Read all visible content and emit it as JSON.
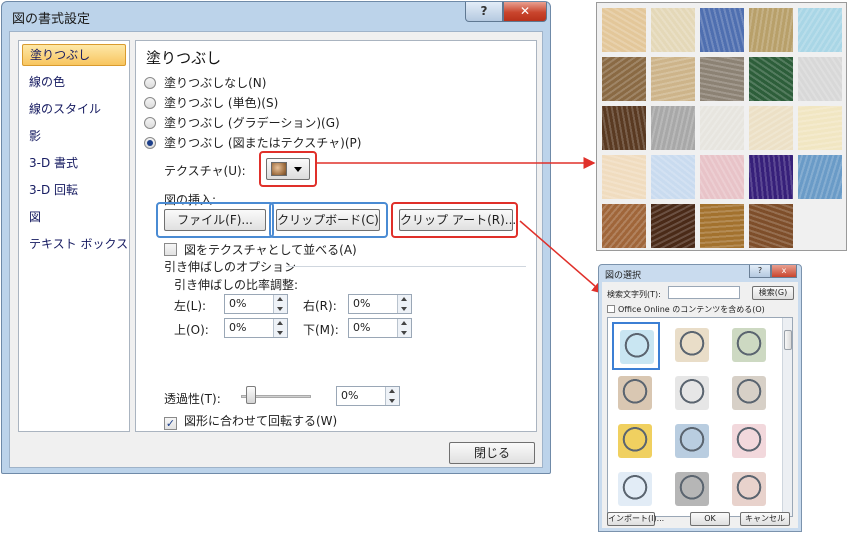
{
  "dialog": {
    "title": "図の書式設定",
    "help_glyph": "?",
    "close_glyph": "✕",
    "close_button": "閉じる"
  },
  "nav": {
    "items": [
      "塗りつぶし",
      "線の色",
      "線のスタイル",
      "影",
      "3-D 書式",
      "3-D 回転",
      "図",
      "テキスト ボックス"
    ],
    "selected": "塗りつぶし"
  },
  "fill": {
    "section_title": "塗りつぶし",
    "options": [
      "塗りつぶしなし(N)",
      "塗りつぶし (単色)(S)",
      "塗りつぶし (グラデーション)(G)",
      "塗りつぶし (図またはテクスチャ)(P)"
    ],
    "selected_option": "塗りつぶし (図またはテクスチャ)(P)",
    "texture_label": "テクスチャ(U):",
    "insert_from_label": "図の挿入:",
    "file_button": "ファイル(F)...",
    "clipboard_button": "クリップボード(C)",
    "clipart_button": "クリップ アート(R)...",
    "tile_checkbox": "図をテクスチャとして並べる(A)",
    "tile_checked": false,
    "stretch_options": "引き伸ばしのオプション",
    "offsets_label": "引き伸ばしの比率調整:",
    "left_label": "左(L):",
    "left_value": "0%",
    "right_label": "右(R):",
    "right_value": "0%",
    "top_label": "上(O):",
    "top_value": "0%",
    "bottom_label": "下(M):",
    "bottom_value": "0%",
    "transparency_label": "透過性(T):",
    "transparency_value": "0%",
    "rotate_checkbox": "図形に合わせて回転する(W)",
    "rotate_checked": true
  },
  "colors": {
    "highlight_blue": "#4a8bd3",
    "highlight_red": "#e0302a",
    "selected_nav": "#f8c55f"
  },
  "textures": [
    "#e3c79a",
    "#e4d8b8",
    "#4f6fb0",
    "#b8a06a",
    "#a9d6e6",
    "#8a6a44",
    "#cdb48a",
    "#8c8274",
    "#2d5e3a",
    "#d8d8d8",
    "#5a3a22",
    "#a8a8a8",
    "#e7e5df",
    "#ece0c6",
    "#f1e6c2",
    "#f0dcbf",
    "#c9dbef",
    "#e8c3c8",
    "#37207a",
    "#6a9bc7",
    "#a0663a",
    "#4a2a18",
    "#a3722e",
    "#7e4e2a"
  ],
  "clipart_dialog": {
    "title": "図の選択",
    "help_glyph": "?",
    "close_glyph": "x",
    "search_label": "検索文字列(T):",
    "search_value": "",
    "search_button": "検索(G)",
    "online_checkbox": "Office Online のコンテンツを含める(O)",
    "online_checked": false,
    "import_button": "インポート(I)...",
    "ok_button": "OK",
    "cancel_button": "キャンセル",
    "clips": [
      "border-clip",
      "man-clip",
      "town-clip",
      "monk-clip",
      "bird-clip",
      "cow-clip",
      "car-clip",
      "eiffel-clip",
      "pattern-clip",
      "rope-clip",
      "helmet-clip",
      "santa-clip"
    ]
  }
}
